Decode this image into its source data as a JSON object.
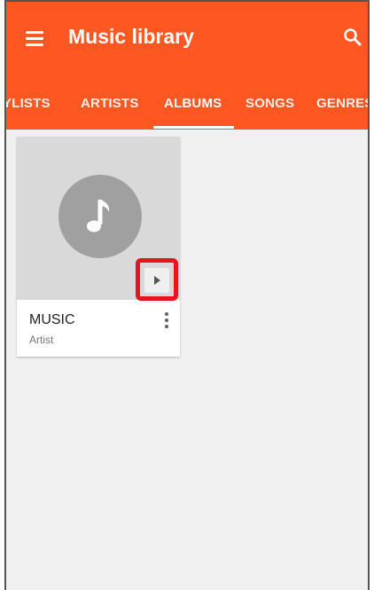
{
  "header": {
    "title": "Music library",
    "accent_color": "#ff5722",
    "menu_icon": "hamburger-menu-icon",
    "search_icon": "search-icon"
  },
  "tabs": [
    {
      "label": "YLISTS",
      "active": false
    },
    {
      "label": "ARTISTS",
      "active": false
    },
    {
      "label": "ALBUMS",
      "active": true
    },
    {
      "label": "SONGS",
      "active": false
    },
    {
      "label": "GENRES",
      "active": false
    }
  ],
  "albums": [
    {
      "title": "MUSIC",
      "artist": "Artist",
      "art_icon": "music-note-icon",
      "play_icon": "play-icon",
      "more_icon": "more-vert-icon"
    }
  ],
  "highlight_color": "#e8141d"
}
